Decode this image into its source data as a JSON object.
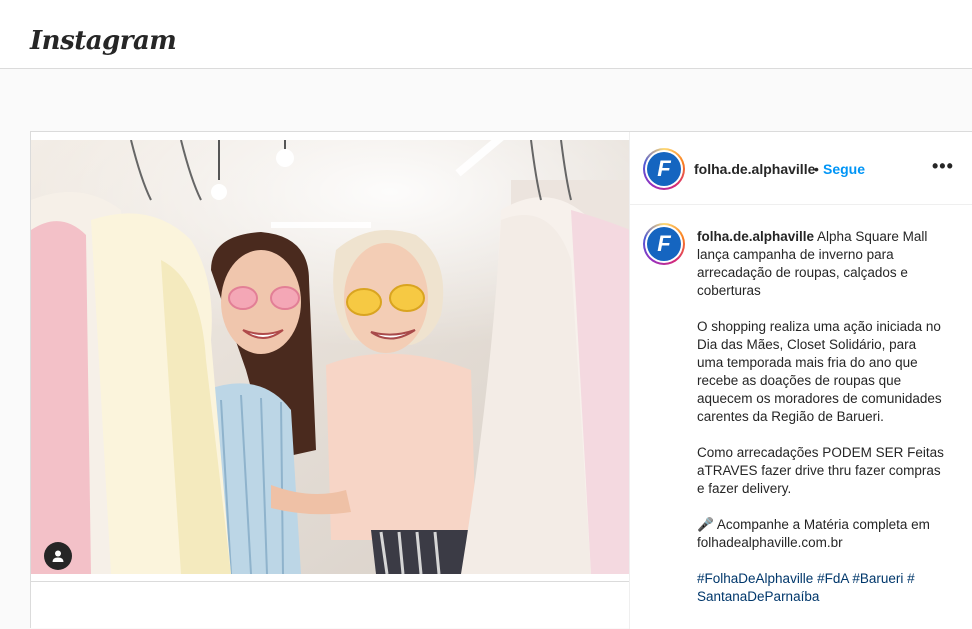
{
  "header": {
    "logo_text": "Instagram"
  },
  "post": {
    "author": {
      "username": "folha.de.alphaville",
      "avatar_letter": "F",
      "follow_separator": "•",
      "follow_label": "Segue"
    },
    "more_label": "•••",
    "image": {
      "user_tag_icon": "person-icon"
    },
    "caption": {
      "username": "folha.de.alphaville",
      "paragraph_1": "Alpha Square Mall lança campanha de inverno para arrecadação de roupas, calçados e coberturas",
      "paragraph_2": "O shopping realiza uma ação iniciada no Dia das Mães, Closet Solidário, para uma temporada mais fria do ano que recebe as doações de roupas que aquecem os moradores de comunidades carentes da Região de Barueri.",
      "paragraph_3": "Como arrecadações PODEM SER Feitas aTRAVES fazer drive thru fazer compras e fazer delivery.",
      "paragraph_4": "🎤 Acompanhe a Matéria completa em folhadealphaville.com.br",
      "hashtags": "#FolhaDeAlphaville #FdA #Barueri # SantanaDeParnaíba"
    }
  },
  "colors": {
    "accent_blue": "#0095f6",
    "hashtag_blue": "#00376b",
    "border": "#dbdbdb",
    "background": "#fafafa"
  }
}
